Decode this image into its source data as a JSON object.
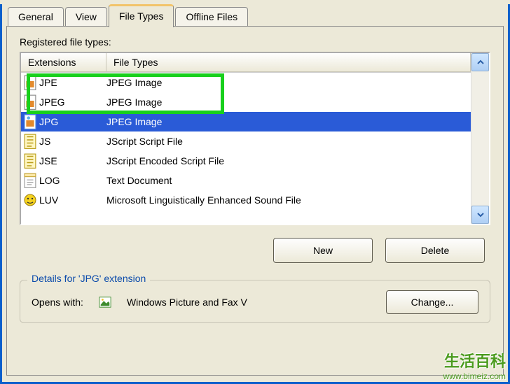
{
  "tabs": [
    "General",
    "View",
    "File Types",
    "Offline Files"
  ],
  "activeTab": 2,
  "section_label": "Registered file types:",
  "columns": {
    "ext": "Extensions",
    "ft": "File Types"
  },
  "rows": [
    {
      "icon": "image-file-icon",
      "ext": "JPE",
      "ft": "JPEG Image",
      "highlighted": true
    },
    {
      "icon": "image-file-icon",
      "ext": "JPEG",
      "ft": "JPEG Image",
      "highlighted": true
    },
    {
      "icon": "image-file-icon",
      "ext": "JPG",
      "ft": "JPEG Image",
      "selected": true
    },
    {
      "icon": "script-file-icon",
      "ext": "JS",
      "ft": "JScript Script File"
    },
    {
      "icon": "script-file-icon",
      "ext": "JSE",
      "ft": "JScript Encoded Script File"
    },
    {
      "icon": "text-file-icon",
      "ext": "LOG",
      "ft": "Text Document"
    },
    {
      "icon": "generic-file-icon",
      "ext": "LUV",
      "ft": "Microsoft Linguistically Enhanced Sound File"
    }
  ],
  "buttons": {
    "new": "New",
    "delete": "Delete",
    "change": "Change..."
  },
  "details": {
    "title": "Details for 'JPG' extension",
    "opens_label": "Opens with:",
    "opens_app": "Windows Picture and Fax V"
  },
  "watermark": {
    "cn": "生活百科",
    "url": "www.bimeiz.com"
  }
}
